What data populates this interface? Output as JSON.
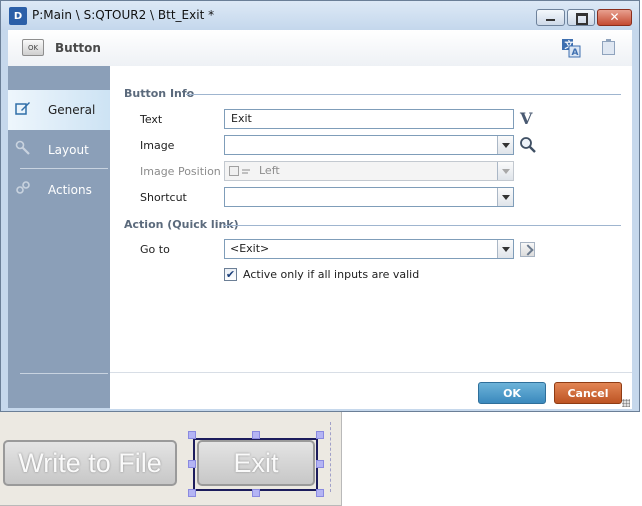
{
  "window": {
    "title": "P:Main \\ S:QTOUR2 \\ Btt_Exit *",
    "app_icon": "D"
  },
  "header": {
    "icon_text": "OK",
    "title": "Button"
  },
  "sidebar": {
    "items": [
      {
        "label": "General",
        "icon": "edit-icon",
        "active": true
      },
      {
        "label": "Layout",
        "icon": "wrench-icon",
        "active": false
      },
      {
        "label": "Actions",
        "icon": "links-icon",
        "active": false
      }
    ]
  },
  "button_info": {
    "section_title": "Button Info",
    "text_label": "Text",
    "text_value": "Exit",
    "image_label": "Image",
    "image_value": "",
    "image_position_label": "Image Position",
    "image_position_value": "Left",
    "shortcut_label": "Shortcut",
    "shortcut_value": ""
  },
  "action": {
    "section_title": "Action (Quick link)",
    "goto_label": "Go to",
    "goto_value": "<Exit>",
    "checkbox_label": "Active only if all inputs are valid",
    "checkbox_checked": true
  },
  "footer": {
    "ok_label": "OK",
    "cancel_label": "Cancel"
  },
  "canvas": {
    "write_button_label": "Write to File",
    "exit_button_label": "Exit"
  },
  "colors": {
    "ok": "#3a89bd",
    "cancel": "#bd5424",
    "sidebar": "#8b9fb8"
  }
}
